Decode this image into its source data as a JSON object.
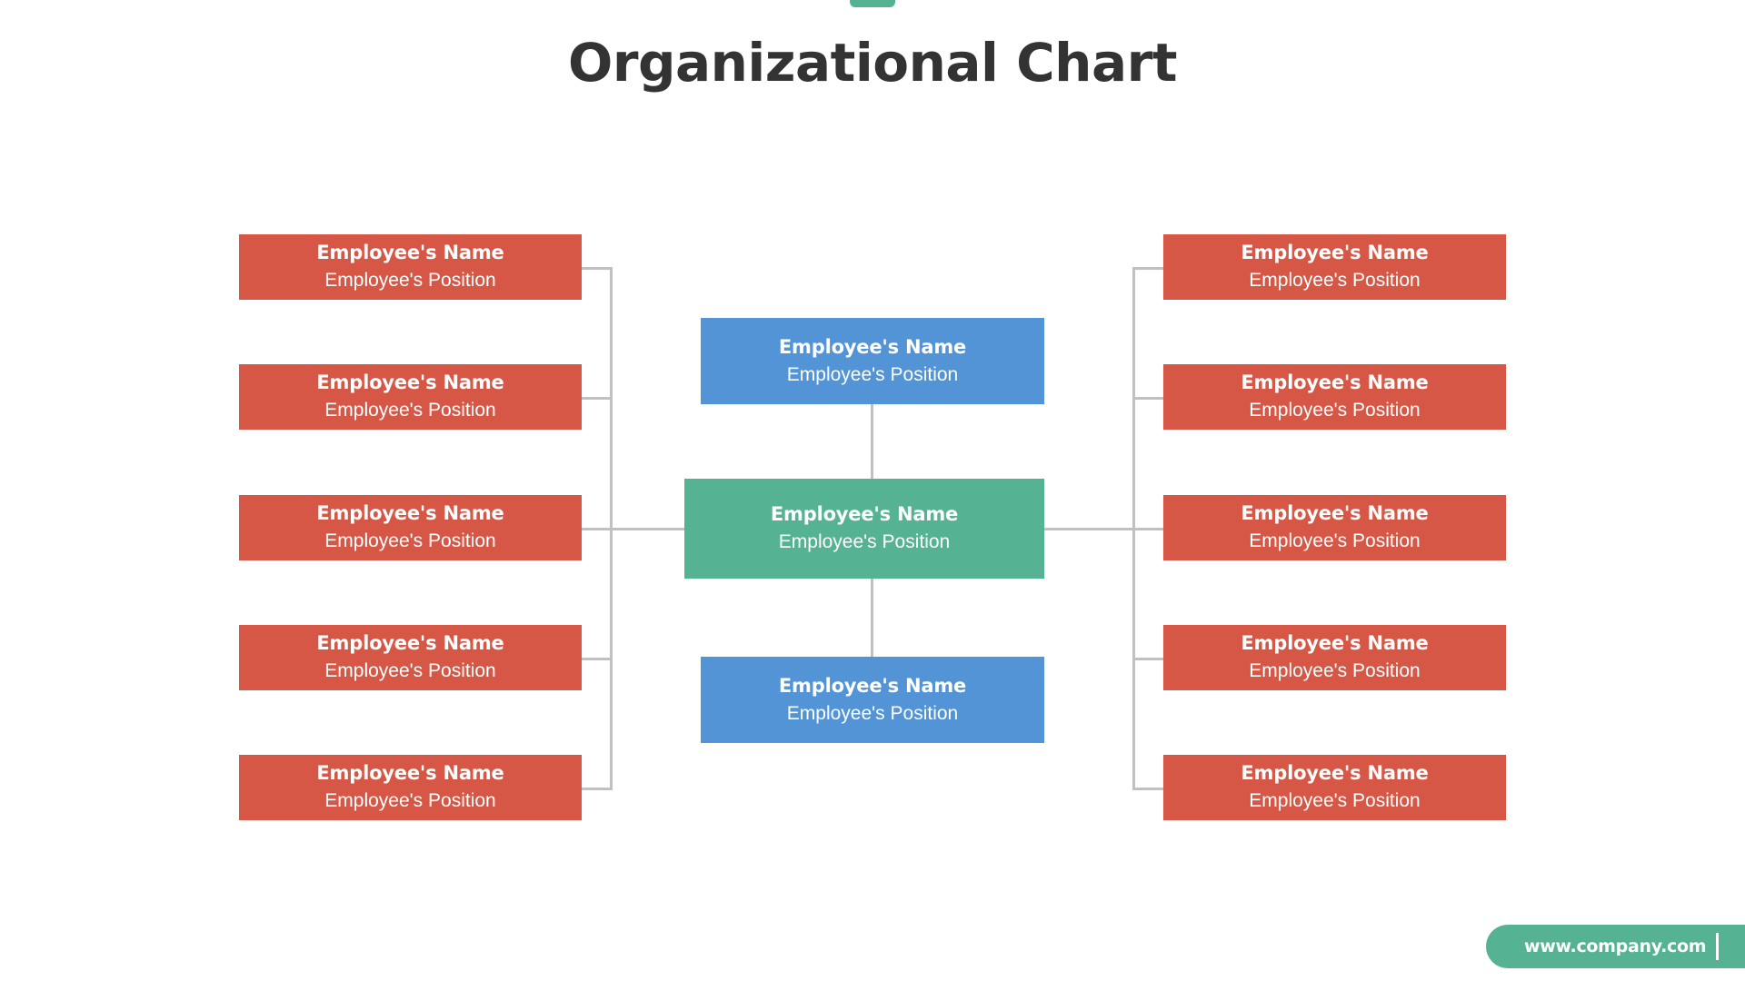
{
  "page": {
    "title": "Organizational Chart",
    "background_color": "#ffffff"
  },
  "accent": {
    "tab_color": "#55b393"
  },
  "colors": {
    "red": "#d65745",
    "blue": "#5294d6",
    "green": "#55b393",
    "connector": "#c0c0c0",
    "title_text": "#333333",
    "node_text": "#ffffff"
  },
  "chart_data": {
    "type": "diagram",
    "title": "Organizational Chart",
    "layout": "hierarchical-org-chart",
    "nodes": [
      {
        "id": "center-top",
        "column": "center",
        "index": 0,
        "color": "#5294d6",
        "name": "Employee's Name",
        "position": "Employee's Position"
      },
      {
        "id": "center-middle",
        "column": "center",
        "index": 1,
        "color": "#55b393",
        "name": "Employee's Name",
        "position": "Employee's Position"
      },
      {
        "id": "center-bottom",
        "column": "center",
        "index": 2,
        "color": "#5294d6",
        "name": "Employee's Name",
        "position": "Employee's Position"
      },
      {
        "id": "left-1",
        "column": "left",
        "index": 0,
        "color": "#d65745",
        "name": "Employee's Name",
        "position": "Employee's Position"
      },
      {
        "id": "left-2",
        "column": "left",
        "index": 1,
        "color": "#d65745",
        "name": "Employee's Name",
        "position": "Employee's Position"
      },
      {
        "id": "left-3",
        "column": "left",
        "index": 2,
        "color": "#d65745",
        "name": "Employee's Name",
        "position": "Employee's Position"
      },
      {
        "id": "left-4",
        "column": "left",
        "index": 3,
        "color": "#d65745",
        "name": "Employee's Name",
        "position": "Employee's Position"
      },
      {
        "id": "left-5",
        "column": "left",
        "index": 4,
        "color": "#d65745",
        "name": "Employee's Name",
        "position": "Employee's Position"
      },
      {
        "id": "right-1",
        "column": "right",
        "index": 0,
        "color": "#d65745",
        "name": "Employee's Name",
        "position": "Employee's Position"
      },
      {
        "id": "right-2",
        "column": "right",
        "index": 1,
        "color": "#d65745",
        "name": "Employee's Name",
        "position": "Employee's Position"
      },
      {
        "id": "right-3",
        "column": "right",
        "index": 2,
        "color": "#d65745",
        "name": "Employee's Name",
        "position": "Employee's Position"
      },
      {
        "id": "right-4",
        "column": "right",
        "index": 3,
        "color": "#d65745",
        "name": "Employee's Name",
        "position": "Employee's Position"
      },
      {
        "id": "right-5",
        "column": "right",
        "index": 4,
        "color": "#d65745",
        "name": "Employee's Name",
        "position": "Employee's Position"
      }
    ],
    "edges": [
      {
        "from": "center-top",
        "to": "center-middle"
      },
      {
        "from": "center-middle",
        "to": "center-bottom"
      },
      {
        "from": "center-middle",
        "to": "left-1"
      },
      {
        "from": "center-middle",
        "to": "left-2"
      },
      {
        "from": "center-middle",
        "to": "left-3"
      },
      {
        "from": "center-middle",
        "to": "left-4"
      },
      {
        "from": "center-middle",
        "to": "left-5"
      },
      {
        "from": "center-middle",
        "to": "right-1"
      },
      {
        "from": "center-middle",
        "to": "right-2"
      },
      {
        "from": "center-middle",
        "to": "right-3"
      },
      {
        "from": "center-middle",
        "to": "right-4"
      },
      {
        "from": "center-middle",
        "to": "right-5"
      }
    ]
  },
  "footer": {
    "url": "www.company.com"
  }
}
